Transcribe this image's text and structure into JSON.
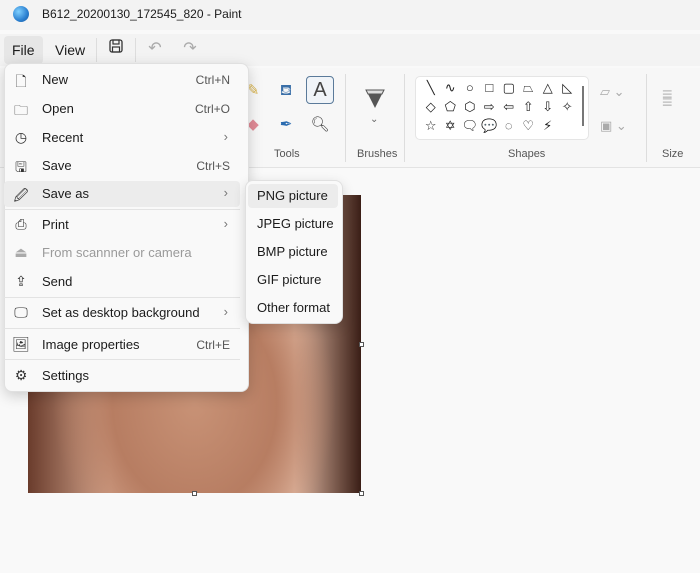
{
  "window": {
    "title": "B612_20200130_172545_820 - Paint"
  },
  "menubar": {
    "file": "File",
    "view": "View"
  },
  "ribbon": {
    "groups": {
      "tools": "Tools",
      "brushes": "Brushes",
      "shapes": "Shapes",
      "size": "Size"
    },
    "text_tool": "A",
    "shapes": [
      "╲",
      "∿",
      "○",
      "□",
      "▢",
      "⏢",
      "△",
      "◺",
      "◇",
      "⬠",
      "⬡",
      "⇨",
      "⇦",
      "⇧",
      "⇩",
      "✧",
      "☆",
      "✡",
      "🗨",
      "💬",
      "◌",
      "♡",
      "⚡"
    ]
  },
  "file_menu": {
    "items": [
      {
        "label": "New",
        "shortcut": "Ctrl+N",
        "icon": "new-file-icon"
      },
      {
        "label": "Open",
        "shortcut": "Ctrl+O",
        "icon": "folder-icon"
      },
      {
        "label": "Recent",
        "icon": "clock-icon"
      },
      {
        "label": "Save",
        "shortcut": "Ctrl+S",
        "icon": "save-icon"
      },
      {
        "label": "Save as",
        "icon": "save-as-icon"
      },
      {
        "label": "Print",
        "icon": "printer-icon"
      },
      {
        "label": "From scannner or camera",
        "icon": "scanner-icon"
      },
      {
        "label": "Send",
        "icon": "share-icon"
      },
      {
        "label": "Set as desktop background",
        "icon": "desktop-icon"
      },
      {
        "label": "Image properties",
        "shortcut": "Ctrl+E",
        "icon": "image-properties-icon"
      },
      {
        "label": "Settings",
        "icon": "gear-icon"
      }
    ]
  },
  "save_as_submenu": {
    "items": [
      "PNG picture",
      "JPEG picture",
      "BMP picture",
      "GIF picture",
      "Other format"
    ]
  }
}
